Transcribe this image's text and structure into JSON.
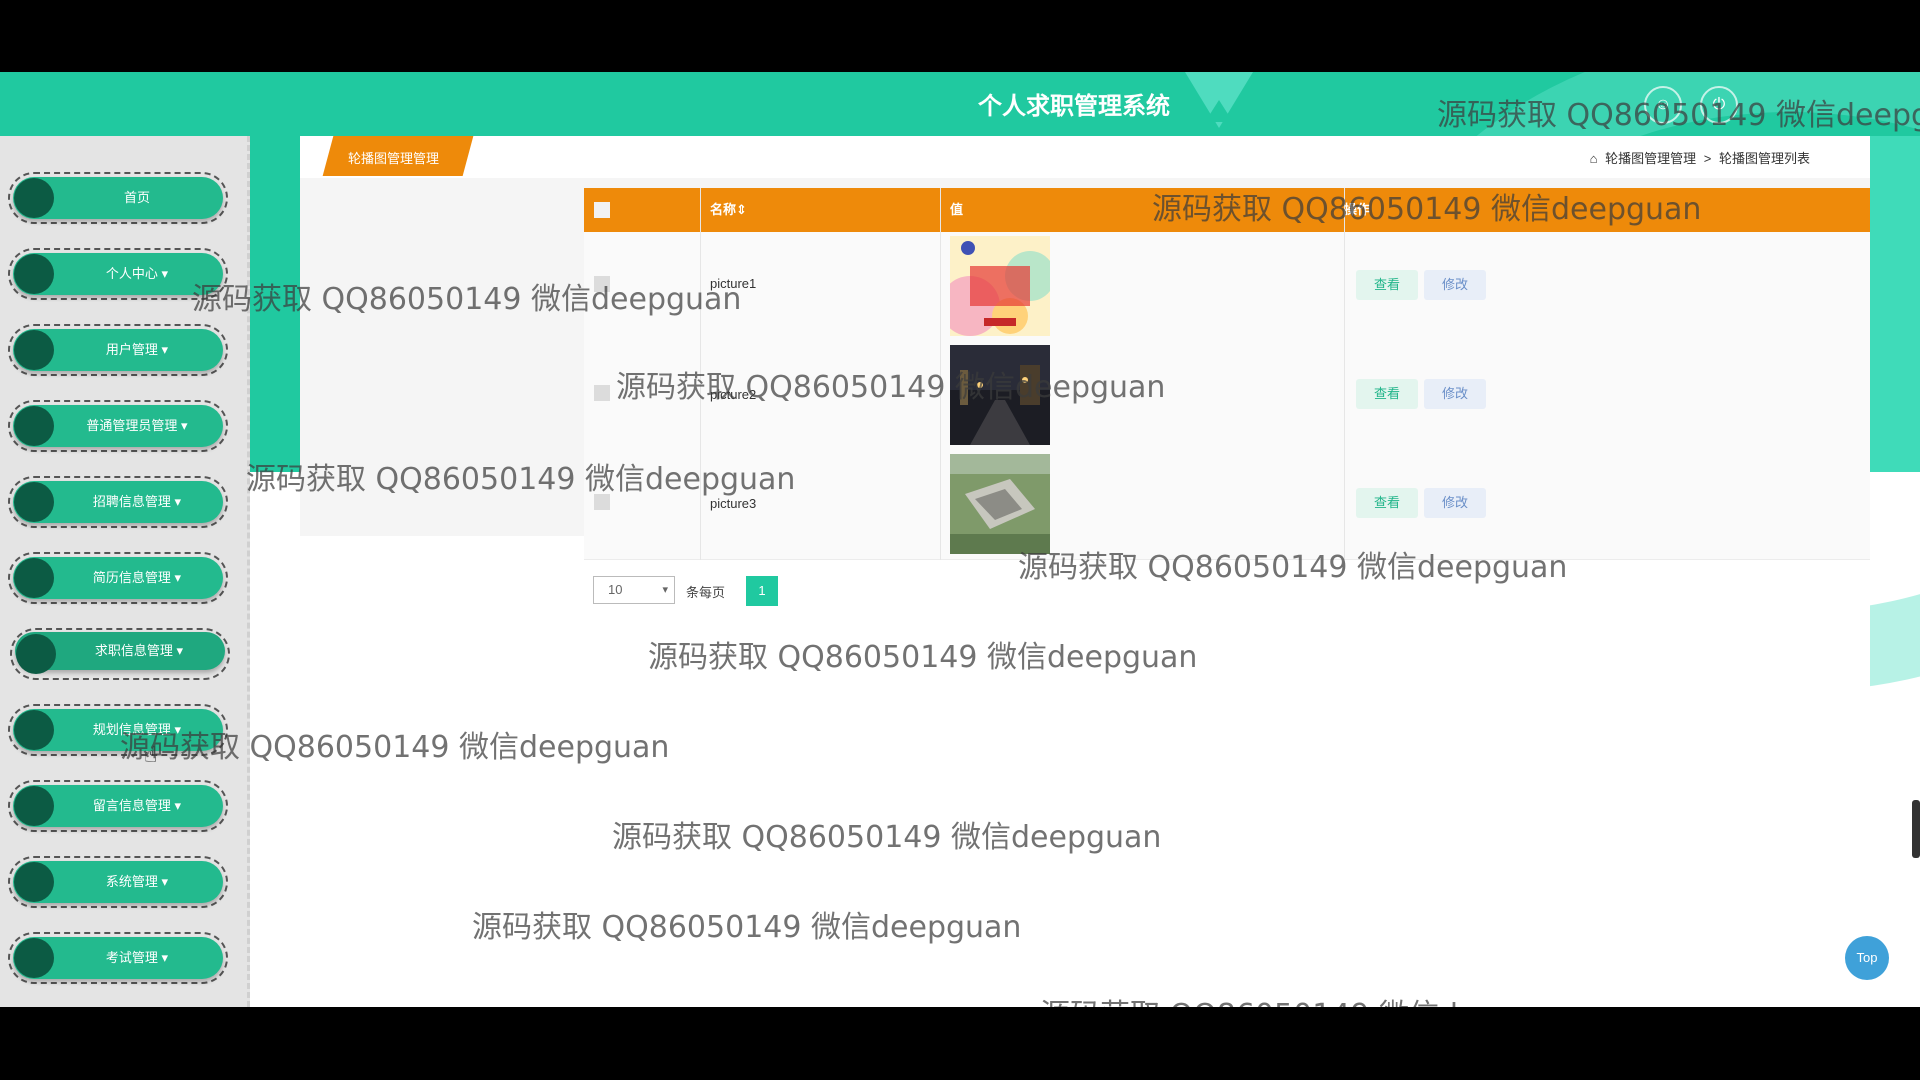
{
  "header": {
    "title": "个人求职管理系统",
    "icons": [
      "user-center-icon",
      "logout-icon"
    ]
  },
  "sidebar": {
    "items": [
      {
        "label": "首页"
      },
      {
        "label": "个人中心 ▾"
      },
      {
        "label": "用户管理 ▾"
      },
      {
        "label": "普通管理员管理 ▾"
      },
      {
        "label": "招聘信息管理 ▾"
      },
      {
        "label": "简历信息管理 ▾"
      },
      {
        "label": "求职信息管理 ▾"
      },
      {
        "label": "规划信息管理 ▾"
      },
      {
        "label": "留言信息管理 ▾"
      },
      {
        "label": "系统管理 ▾"
      },
      {
        "label": "考试管理 ▾"
      }
    ],
    "active_index": 6
  },
  "tab": {
    "label": "轮播图管理管理"
  },
  "breadcrumb": {
    "home_icon": "home-icon",
    "level1": "轮播图管理管理",
    "separator": ">",
    "level2": "轮播图管理列表"
  },
  "table": {
    "headers": {
      "name": "名称⇕",
      "value": "值",
      "action": "操作"
    },
    "rows": [
      {
        "name": "picture1",
        "image": "colorful-poster-thumbnail"
      },
      {
        "name": "picture2",
        "image": "night-street-thumbnail"
      },
      {
        "name": "picture3",
        "image": "aerial-campus-thumbnail"
      }
    ],
    "view_label": "查看",
    "edit_label": "修改"
  },
  "pagination": {
    "page_size": "10",
    "per_page_label": "条每页",
    "current_page": "1"
  },
  "top_button": {
    "label": "Top"
  },
  "watermark": "源码获取 QQ86050149 微信deepguan",
  "colors": {
    "header": "#20c9a0",
    "tab": "#ee8a0a",
    "menu_pill": "#23ba8e",
    "menu_ball": "#0c5b44",
    "top_button": "#3fa1d9"
  }
}
